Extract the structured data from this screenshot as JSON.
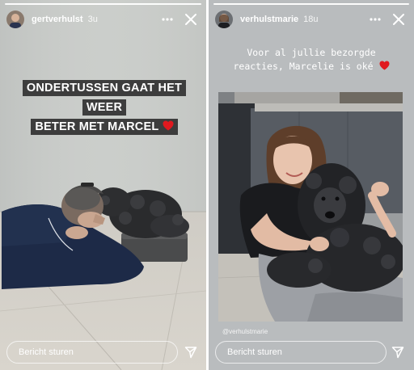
{
  "left_story": {
    "username": "gertverhulst",
    "time": "3u",
    "caption_line1": "ONDERTUSSEN GAAT HET WEER",
    "caption_line2": "BETER MET MARCEL",
    "heart": "❤️",
    "reply_placeholder": "Bericht sturen"
  },
  "right_story": {
    "username": "verhulstmarie",
    "time": "18u",
    "caption_line1": "Voor al jullie bezorgde",
    "caption_line2": "reacties, Marcelie is oké",
    "heart": "❤️",
    "mention": "@verhulstmarie",
    "reply_placeholder": "Bericht sturen"
  },
  "icons": {
    "more": "more-dots-icon",
    "close": "close-icon",
    "send": "paper-plane-icon"
  },
  "colors": {
    "heart": "#e0191f",
    "caption_bg": "#3d3d3d"
  }
}
